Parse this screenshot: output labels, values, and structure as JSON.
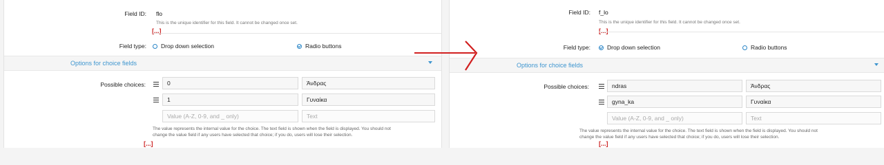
{
  "left": {
    "field_id_label": "Field ID:",
    "field_id_value": "flo",
    "field_id_hint": "This is the unique identifier for this field. It cannot be changed once set.",
    "ellipsis_top": "[...]",
    "field_type_label": "Field type:",
    "radio_dropdown": "Drop down selection",
    "radio_buttons": "Radio buttons",
    "selected": "radio_buttons",
    "section_title": "Options for choice fields",
    "choices_label": "Possible choices:",
    "choices": [
      {
        "value": "0",
        "text": "Άνδρας"
      },
      {
        "value": "1",
        "text": "Γυναίκα"
      }
    ],
    "value_placeholder": "Value (A-Z, 0-9, and _ only)",
    "text_placeholder": "Text",
    "explanation_line1": "The value represents the internal value for the choice. The text field is shown when the field is displayed. You should not",
    "explanation_line2": "change the value field if any users have selected that choice; if you do, users will lose their selection.",
    "ellipsis_bottom": "[...]"
  },
  "right": {
    "field_id_label": "Field ID:",
    "field_id_value": "f_lo",
    "field_id_hint": "This is the unique identifier for this field. It cannot be changed once set.",
    "ellipsis_top": "[...]",
    "field_type_label": "Field type:",
    "radio_dropdown": "Drop down selection",
    "radio_buttons": "Radio buttons",
    "selected": "dropdown",
    "section_title": "Options for choice fields",
    "choices_label": "Possible choices:",
    "choices": [
      {
        "value": "ndras",
        "text": "Άνδρας"
      },
      {
        "value": "gyna_ka",
        "text": "Γυναίκα"
      }
    ],
    "value_placeholder": "Value (A-Z, 0-9, and _ only)",
    "text_placeholder": "Text",
    "explanation_line1": "The value represents the internal value for the choice. The text field is shown when the field is displayed. You should not",
    "explanation_line2": "change the value field if any users have selected that choice; if you do, users will lose their selection.",
    "ellipsis_bottom": "[...]"
  },
  "colors": {
    "accent": "#3d95cf",
    "arrow": "#d11f1f",
    "ellipsis": "#cc2222"
  },
  "icons": {
    "drag_handle": "hamburger-icon",
    "expand": "chevron-down-icon",
    "radio_checked": "radio-checked-icon",
    "radio_unchecked": "radio-unchecked-icon"
  }
}
